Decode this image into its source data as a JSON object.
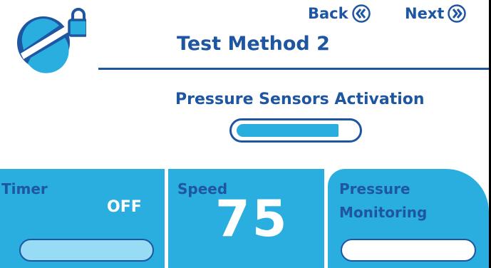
{
  "header": {
    "back_label": "Back",
    "next_label": "Next",
    "title": "Test Method 2"
  },
  "pressure_sensors": {
    "label": "Pressure Sensors Activation",
    "level": 0.86
  },
  "panels": {
    "timer": {
      "label": "Timer",
      "value": "OFF"
    },
    "speed": {
      "label": "Speed",
      "value": "75"
    },
    "pressure_monitoring": {
      "label_line1": "Pressure",
      "label_line2": "Monitoring"
    }
  },
  "colors": {
    "brand_blue": "#1f56a1",
    "accent_cyan": "#2aaedf",
    "light_cyan": "#97dcf4"
  },
  "icons": {
    "logo": "gauge-logo-icon",
    "lock": "lock-icon",
    "back": "double-chevron-left-icon",
    "next": "double-chevron-right-icon"
  }
}
